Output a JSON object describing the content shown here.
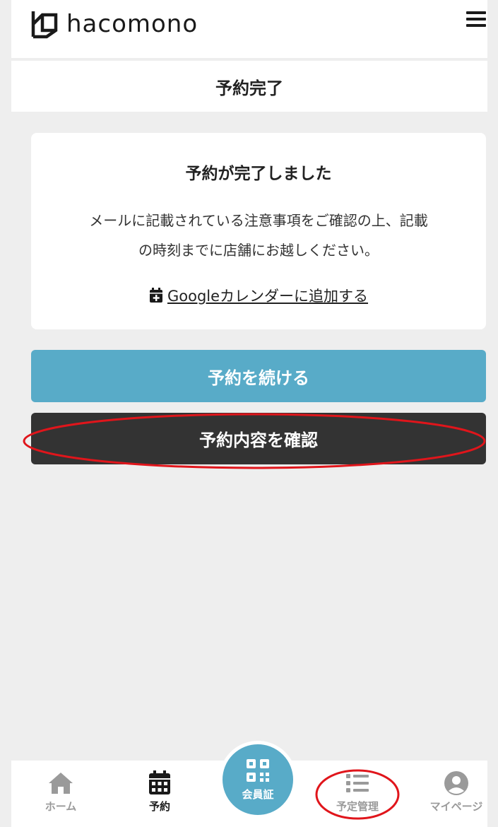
{
  "header": {
    "logo_text": "hacomono"
  },
  "page": {
    "title": "予約完了"
  },
  "card": {
    "title": "予約が完了しました",
    "message_line1": "メールに記載されている注意事項をご確認の上、記載",
    "message_line2": "の時刻までに店舗にお越しください。",
    "calendar_link": "Googleカレンダーに追加する"
  },
  "buttons": {
    "continue": "予約を続ける",
    "confirm": "予約内容を確認"
  },
  "nav": {
    "home": "ホーム",
    "reserve": "予約",
    "member_card": "会員証",
    "schedule": "予定管理",
    "mypage": "マイページ"
  },
  "colors": {
    "accent": "#58abc8",
    "dark_button": "#333333",
    "annotation": "#e0151b"
  }
}
